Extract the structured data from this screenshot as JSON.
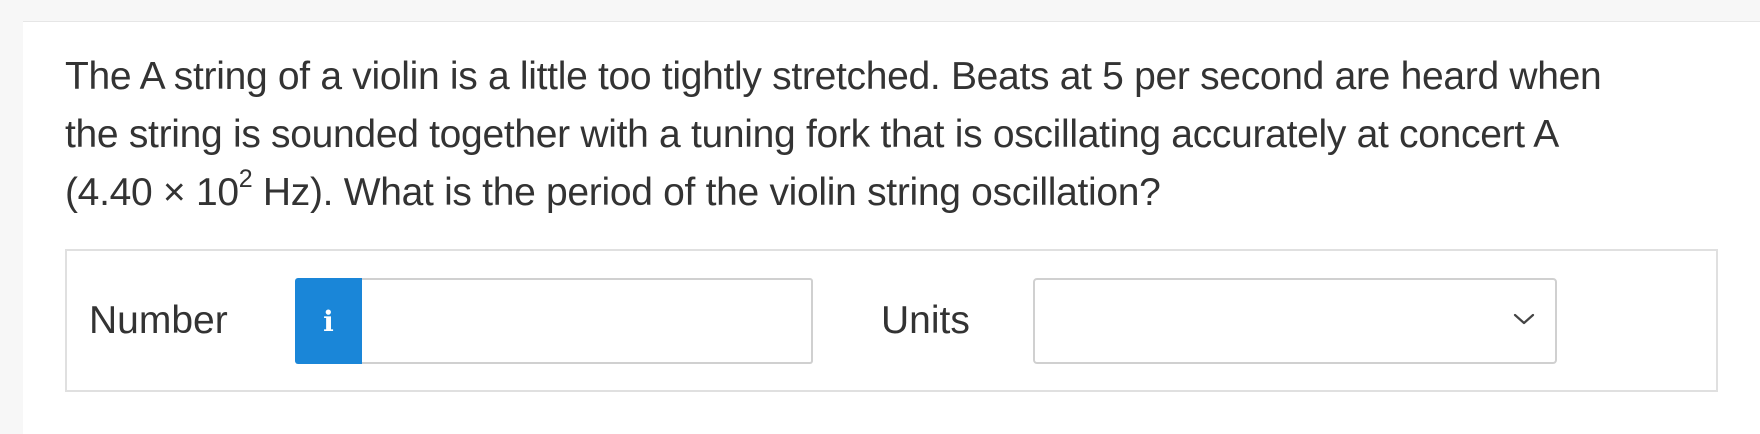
{
  "question": {
    "line1": "The A string of a violin is a little too tightly stretched. Beats at 5 per second are heard when",
    "line2": "the string is sounded together with a tuning fork that is oscillating accurately at concert A",
    "line3_before_exp": "(4.40 × 10",
    "line3_exponent": "2",
    "line3_after_exp": " Hz). What is the period of the violin string oscillation?"
  },
  "answer": {
    "number_label": "Number",
    "info_glyph": "i",
    "number_value": "",
    "units_label": "Units",
    "units_selected": ""
  },
  "icons": {
    "info": "info-icon",
    "dropdown": "chevron-down-icon"
  },
  "colors": {
    "accent": "#1a86d8",
    "text": "#333333",
    "border": "#d0d0d0"
  }
}
